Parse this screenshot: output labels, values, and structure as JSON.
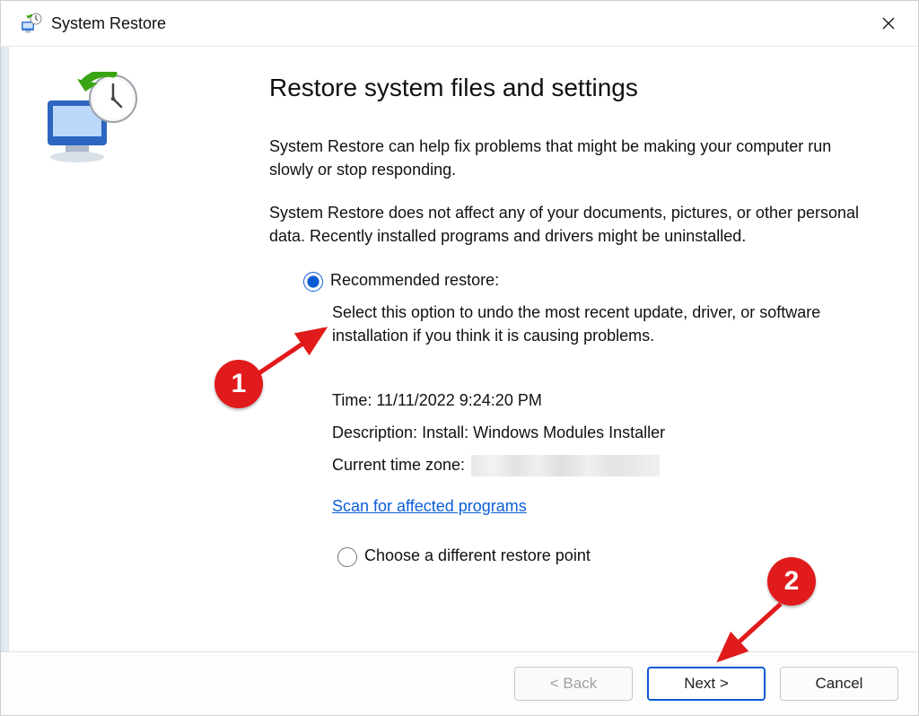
{
  "titlebar": {
    "title": "System Restore"
  },
  "heading": "Restore system files and settings",
  "para1": "System Restore can help fix problems that might be making your computer run slowly or stop responding.",
  "para2": "System Restore does not affect any of your documents, pictures, or other personal data. Recently installed programs and drivers might be uninstalled.",
  "options": {
    "recommended": {
      "label": "Recommended restore:",
      "description": "Select this option to undo the most recent update, driver, or software installation if you think it is causing problems.",
      "time_label": "Time:",
      "time_value": "11/11/2022 9:24:20 PM",
      "desc_label": "Description:",
      "desc_value": "Install: Windows Modules Installer",
      "tz_label": "Current time zone:",
      "tz_value": ""
    },
    "scan_link": "Scan for affected programs",
    "different": {
      "label": "Choose a different restore point"
    }
  },
  "buttons": {
    "back": "< Back",
    "next": "Next >",
    "cancel": "Cancel"
  },
  "annotations": {
    "b1": "1",
    "b2": "2"
  }
}
